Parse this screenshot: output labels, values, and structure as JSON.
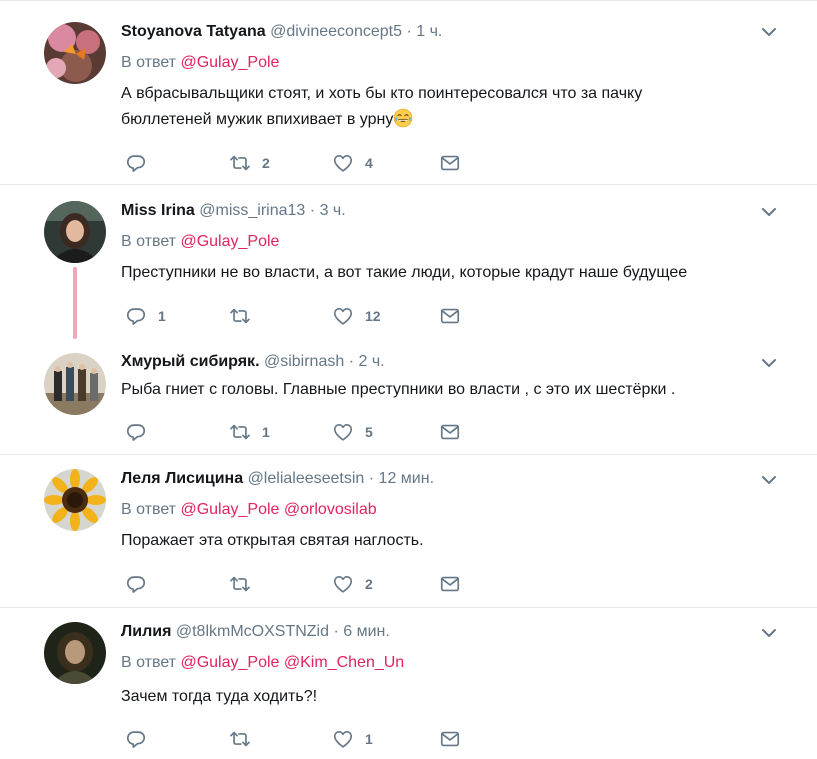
{
  "replying_prefix": "В ответ",
  "colors": {
    "mention": "#e0245e",
    "muted": "#657786",
    "thread_line": "#f4a7b4"
  },
  "icons": {
    "reply": "reply-icon",
    "retweet": "retweet-icon",
    "like": "heart-icon",
    "dm": "envelope-icon",
    "more": "chevron-down-icon"
  },
  "tweets": [
    {
      "name": "Stoyanova Tatyana",
      "handle": "@divineeconcept5",
      "dot": "·",
      "time": "1 ч.",
      "mentions": [
        "@Gulay_Pole"
      ],
      "text_line1": "А вбрасывальщики стоят, и хоть бы кто поинтересовался что за пачку",
      "text_line2": "бюллетеней мужик впихивает в урну",
      "emoji": "face-with-tears-of-joy",
      "reply_count": "",
      "retweet_count": "2",
      "like_count": "4"
    },
    {
      "name": "Miss Irina",
      "handle": "@miss_irina13",
      "dot": "·",
      "time": "3 ч.",
      "mentions": [
        "@Gulay_Pole"
      ],
      "text": "Преступники не во власти, а вот такие люди, которые крадут наше будущее",
      "reply_count": "1",
      "retweet_count": "",
      "like_count": "12"
    },
    {
      "name": "Хмурый сибиряк.",
      "handle": "@sibirnash",
      "dot": "·",
      "time": "2 ч.",
      "text": "Рыба гниет с головы. Главные преступники во власти , с это их шестёрки .",
      "reply_count": "",
      "retweet_count": "1",
      "like_count": "5"
    },
    {
      "name": "Леля Лисицина",
      "handle": "@lelialeeseetsin",
      "dot": "·",
      "time": "12 мин.",
      "mentions": [
        "@Gulay_Pole",
        "@orlovosilab"
      ],
      "text": "Поражает эта открытая святая наглость.",
      "reply_count": "",
      "retweet_count": "",
      "like_count": "2"
    },
    {
      "name": "Лилия",
      "handle": "@t8lkmMcOXSTNZid",
      "dot": "·",
      "time": "6 мин.",
      "mentions": [
        "@Gulay_Pole",
        "@Kim_Chen_Un"
      ],
      "text": "Зачем тогда туда ходить?!",
      "reply_count": "",
      "retweet_count": "",
      "like_count": "1"
    }
  ]
}
